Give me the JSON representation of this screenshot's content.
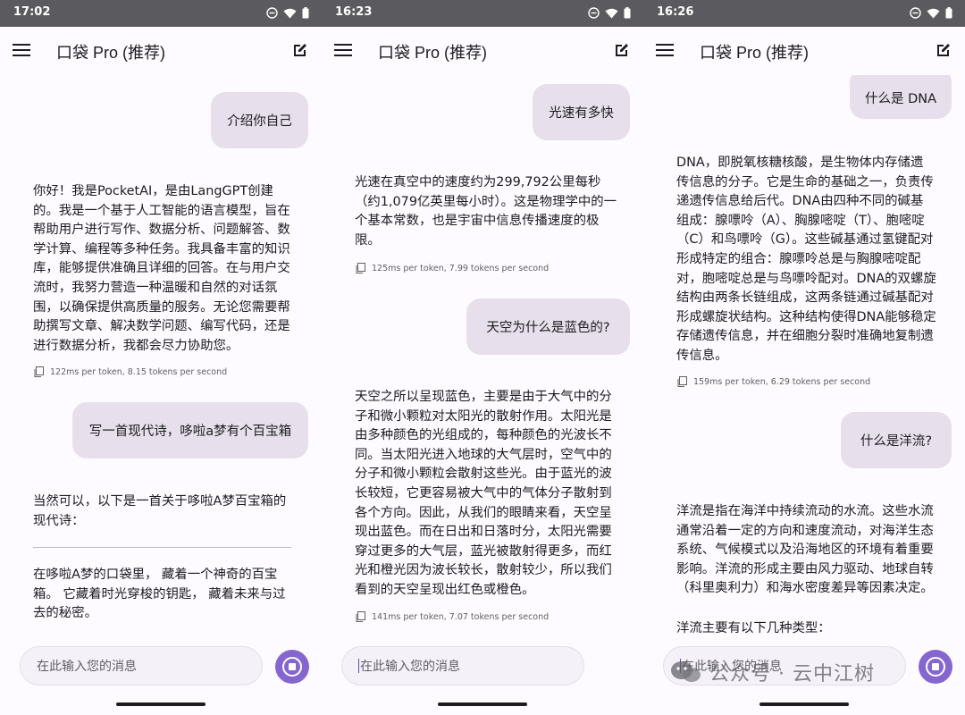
{
  "app_title": "口袋 Pro (推荐)",
  "accent_color": "#8566cf",
  "user_bubble_color": "#e7e0ec",
  "input_placeholder": "在此输入您的消息",
  "watermark": "公众号 · 云中江树",
  "screens": [
    {
      "time": "17:02",
      "messages": [
        {
          "role": "user",
          "text": "介绍你自己"
        },
        {
          "role": "assistant",
          "lines": [
            "你好！我是PocketAI，是由LangGPT创建",
            "的。我是一个基于人工智能的语言模型，旨在",
            "帮助用户进行写作、数据分析、问题解答、数",
            "学计算、编程等多种任务。我具备丰富的知识",
            "库，能够提供准确且详细的回答。在与用户交",
            "流时，我努力营造一种温暖和自然的对话氛",
            "围，以确保提供高质量的服务。无论您需要帮",
            "助撰写文章、解决数学问题、编写代码，还是",
            "进行数据分析，我都会尽力协助您。"
          ],
          "stats": "122ms per token, 8.15 tokens per second"
        },
        {
          "role": "user",
          "text": "写一首现代诗，哆啦a梦有个百宝箱"
        },
        {
          "role": "assistant",
          "lines": [
            "当然可以，以下是一首关于哆啦A梦百宝箱的",
            "现代诗："
          ]
        },
        {
          "role": "assistant",
          "lines": [
            "在哆啦A梦的口袋里， 藏着一个神奇的百宝",
            "箱。 它藏着时光穿梭的钥匙， 藏着未来与过",
            "去的秘密。"
          ]
        }
      ]
    },
    {
      "time": "16:23",
      "messages": [
        {
          "role": "user",
          "text": "光速有多快"
        },
        {
          "role": "assistant",
          "lines": [
            "光速在真空中的速度约为299,792公里每秒",
            "（约1,079亿英里每小时）。这是物理学中的一",
            "个基本常数，也是宇宙中信息传播速度的极",
            "限。"
          ],
          "stats": "125ms per token, 7.99 tokens per second"
        },
        {
          "role": "user",
          "text": "天空为什么是蓝色的?"
        },
        {
          "role": "assistant",
          "lines": [
            "天空之所以呈现蓝色，主要是由于大气中的分",
            "子和微小颗粒对太阳光的散射作用。太阳光是",
            "由多种颜色的光组成的，每种颜色的光波长不",
            "同。当太阳光进入地球的大气层时，空气中的",
            "分子和微小颗粒会散射这些光。由于蓝光的波",
            "长较短，它更容易被大气中的气体分子散射到",
            "各个方向。因此，从我们的眼睛来看，天空呈",
            "现出蓝色。而在日出和日落时分，太阳光需要",
            "穿过更多的大气层，蓝光被散射得更多，而红",
            "光和橙光因为波长较长，散射较少，所以我们",
            "看到的天空呈现出红色或橙色。"
          ],
          "stats": "141ms per token, 7.07 tokens per second"
        }
      ]
    },
    {
      "time": "16:26",
      "messages": [
        {
          "role": "user",
          "text": "什么是 DNA"
        },
        {
          "role": "assistant",
          "lines": [
            "DNA，即脱氧核糖核酸，是生物体内存储遗",
            "传信息的分子。它是生命的基础之一，负责传",
            "递遗传信息给后代。DNA由四种不同的碱基",
            "组成：腺嘌呤（A）、胸腺嘧啶（T）、胞嘧啶",
            "（C）和鸟嘌呤（G）。这些碱基通过氢键配对",
            "形成特定的组合：腺嘌呤总是与胸腺嘧啶配",
            "对，胞嘧啶总是与鸟嘌呤配对。DNA的双螺旋",
            "结构由两条长链组成，这两条链通过碱基配对",
            "形成螺旋状结构。这种结构使得DNA能够稳定",
            "存储遗传信息，并在细胞分裂时准确地复制遗",
            "传信息。"
          ],
          "stats": "159ms per token, 6.29 tokens per second"
        },
        {
          "role": "user",
          "text": "什么是洋流?"
        },
        {
          "role": "assistant",
          "lines": [
            "洋流是指在海洋中持续流动的水流。这些水流",
            "通常沿着一定的方向和速度流动，对海洋生态",
            "系统、气候模式以及沿海地区的环境有着重要",
            "影响。洋流的形成主要由风力驱动、地球自转",
            "（科里奥利力）和海水密度差异等因素决定。"
          ]
        },
        {
          "role": "assistant",
          "lines": [
            "洋流主要有以下几种类型："
          ]
        }
      ]
    }
  ]
}
